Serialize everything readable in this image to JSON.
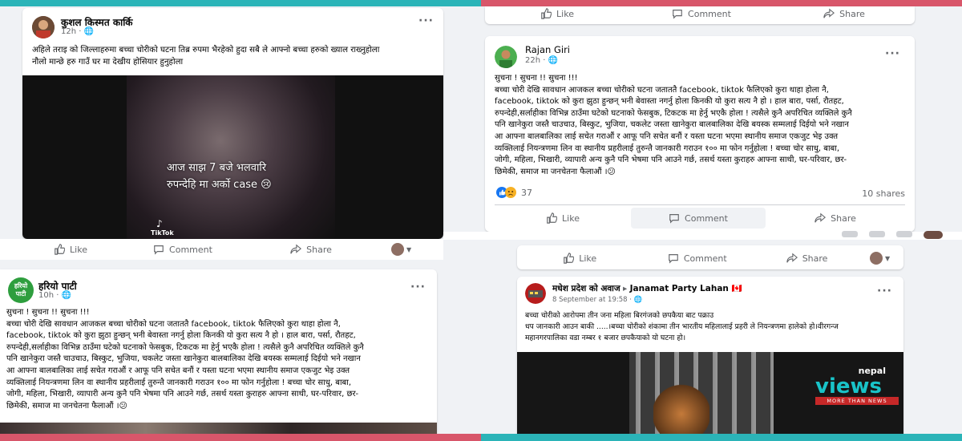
{
  "post1": {
    "author": "कुशल किस्मत कार्कि",
    "time": "12h",
    "text": "अहिले तराइ को जिल्लाहरुमा बच्चा चोरीको घटना  तिब्र रुपमा भैरहेको हुदा सबै ले आफ्नो बच्चा हरुको ख्याल राख्नुहोला\nनौलो मान्छे हरु गाउँ घर मा देखीय होसियार हुनुहोला",
    "video_caption_line1": "आज साझ 7 बजे भलवारि",
    "video_caption_line2": "रुपन्देहि मा अर्को case 😢",
    "watermark": "TikTok"
  },
  "actions": {
    "like": "Like",
    "comment": "Comment",
    "share": "Share"
  },
  "post2": {
    "author": "हरियो पाटी",
    "avatar_text_1": "हरियो",
    "avatar_text_2": "पाटी",
    "time": "10h",
    "text": "सुचना ! सुचना !! सुचना !!!\nबच्चा चोरी देखि सावधान आजकल बच्चा चोरीको घटना जताततै facebook, tiktok फैलिएको कुरा थाहा होला नै,\nfacebook, tiktok को कुरा झुठा हुन्छन् भनी बेवास्ता नगर्नु होला किनकी यो कुरा सत्य नै हो । हाल बारा, पर्सा, रौतहट,\nरुपन्देही,सर्लाहीका विभिन्न ठाउँमा घटेको घटनाको फेसबुक, टिकटक मा हेर्नु भएकै होला ! त्यसैले कुनै अपरिचित व्यक्तिले कुनै\nपनि खानेकुरा जस्तै चाउचाउ, बिस्कुट, भुजिया, चकलेट जस्ता खानेकुरा बालबालिका देखि बयस्क सम्मलाई दिईयो भने नखान\nआ आफ्ना बालबालिका लाई सचेत गराऔं र आफू पनि सचेत बनौं र यस्ता घटना भएमा स्थानीय समाज एकजुट भेइ उक्त\nव्यक्तिलाई नियन्त्रणमा लिन वा स्थानीय प्रहरीलाई तुरुन्तै जानकारी गराउन १०० मा फोन गर्नुहोला ! बच्चा चोर साधु, बाबा,\nजोगी, महिला, भिखारी, व्यापारी अन्य कुनै पनि भेषमा पनि आउने गर्छ, तसर्थ यस्ता कुराहरु आफ्ना साथी, घर-परिवार, छर-\nछिमेकी, समाज मा जनचेतना फैलाऔं ।😕"
  },
  "post3": {
    "author": "Rajan Giri",
    "time": "22h",
    "text": "सुचना ! सुचना !! सुचना !!!\nबच्चा चोरी देखि सावधान आजकल बच्चा चोरीको घटना जताततै facebook, tiktok फैलिएको कुरा थाहा होला नै,\nfacebook, tiktok को कुरा झुठा हुन्छन् भनी बेवास्ता नगर्नु होला किनकी यो कुरा सत्य नै हो । हाल बारा, पर्सा, रौतहट,\nरुपन्देही,सर्लाहीका विभिन्न ठाउँमा घटेको घटनाको फेसबुक, टिकटक मा हेर्नु भएकै होला ! त्यसैले कुनै अपरिचित व्यक्तिले कुनै\nपनि खानेकुरा जस्तै चाउचाउ, बिस्कुट, भुजिया, चकलेट जस्ता खानेकुरा बालबालिका देखि बयस्क सम्मलाई दिईयो भने नखान\nआ आफ्ना बालबालिका लाई सचेत गराऔं र आफू पनि सचेत बनौं र यस्ता घटना भएमा स्थानीय समाज एकजुट भेइ उक्त\nव्यक्तिलाई नियन्त्रणमा लिन वा स्थानीय प्रहरीलाई तुरुन्तै जानकारी गराउन १०० मा फोन गर्नुहोला ! बच्चा चोर साधु, बाबा,\nजोगी, महिला, भिखारी, व्यापारी अन्य कुनै पनि भेषमा पनि आउने गर्छ, तसर्थ यस्ता कुराहरु आफ्ना साथी, घर-परिवार, छर-\nछिमेकी, समाज मा जनचेतना फैलाऔं ।😕",
    "reactions_count": "37",
    "shares": "10 shares"
  },
  "post4": {
    "author": "मधेश प्रदेश को अवाज",
    "group": "Janamat Party Lahan 🇨🇦",
    "time": "8 September at 19:58",
    "text": "बच्चा चोरीको आरोपमा तीन जना महिला बिरगंजको छपकैया बाट पक्राउ\nधप जानकारी आउन बाकी .....।बच्चा चोरीको शंकामा तीन भारतीय महिलालाई प्रहरी ले नियन्त्रणमा हालेको हो।वीरगन्ज\nमहानगरपालिका वडा नम्बर १ बजार छपकैयाको यो घटना हो।",
    "brand_top": "nepal",
    "brand_main": "views",
    "brand_tag": "MORE THAN NEWS"
  },
  "colors": {
    "band_teal": "#2bb4b8",
    "band_pink": "#d8566a",
    "fb_gray": "#65676b",
    "link_blue": "#1877f2"
  }
}
